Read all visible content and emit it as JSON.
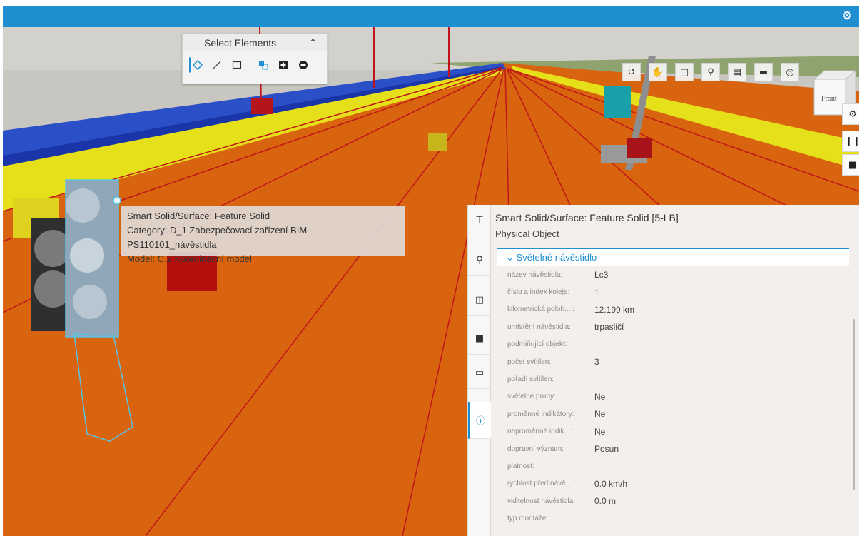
{
  "topbar": {
    "settings_icon": "gear-icon",
    "color": "#1f8fd1"
  },
  "select_panel": {
    "title": "Select Elements",
    "collapse_icon": "chevron-up-icon",
    "tools": [
      "point-select-icon",
      "line-select-icon",
      "box-select-icon",
      "selection-set-icon",
      "add-selection-icon",
      "remove-selection-icon"
    ]
  },
  "nav_tools": [
    "rotate-icon",
    "pan-icon",
    "fit-view-icon",
    "zoom-icon",
    "section-icon",
    "window-icon",
    "globe-icon"
  ],
  "view_cube": {
    "face": "Front"
  },
  "side_tools": [
    "camera-settings-icon",
    "walk-icon",
    "video-icon"
  ],
  "tooltip": {
    "line1": "Smart Solid/Surface: Feature Solid",
    "line2": "Category: D_1 Zabezpečovací zařízení BIM - PS110101_návěstidla",
    "line3": "Model: C.2 Koordinační model"
  },
  "properties": {
    "title": "Smart Solid/Surface: Feature Solid [5-LB]",
    "subtitle": "Physical Object",
    "section": "Světelné návěstidlo",
    "rows": [
      {
        "k": "název návěstidla:",
        "v": "Lc3"
      },
      {
        "k": "číslo a index koleje:",
        "v": "1"
      },
      {
        "k": "kilometrická poloh... :",
        "v": "12.199 km"
      },
      {
        "k": "umístění návěstidla:",
        "v": "trpasličí"
      },
      {
        "k": "podmiňující objekt:",
        "v": ""
      },
      {
        "k": "počet svítilen:",
        "v": "3"
      },
      {
        "k": "pořadí svítilen:",
        "v": ""
      },
      {
        "k": "světelné pruhy:",
        "v": "Ne"
      },
      {
        "k": "proměnné indikátory:",
        "v": "Ne"
      },
      {
        "k": "neproměnné indik... :",
        "v": "Ne"
      },
      {
        "k": "dopravní význam:",
        "v": "Posun"
      },
      {
        "k": "platnost:",
        "v": ""
      },
      {
        "k": "rychlost před návě... :",
        "v": "0.0 km/h"
      },
      {
        "k": "viditelnost návěstidla:",
        "v": "0.0 m"
      },
      {
        "k": "typ montáže:",
        "v": ""
      }
    ],
    "tabs": [
      "tree-icon",
      "search-icon",
      "model-icon",
      "markup-icon",
      "view-icon",
      "info-icon"
    ]
  }
}
